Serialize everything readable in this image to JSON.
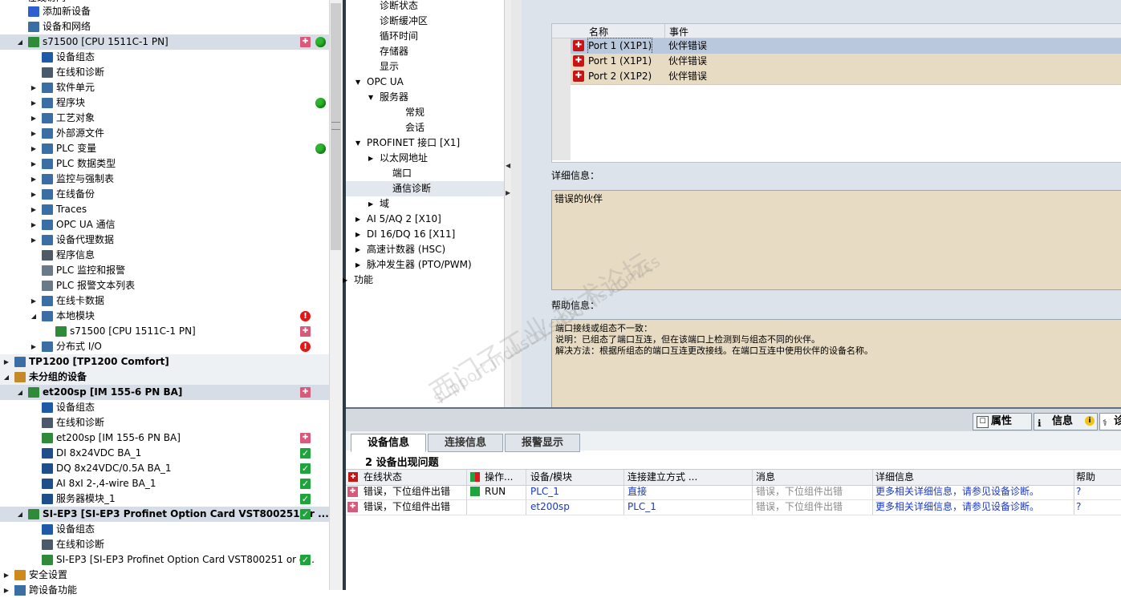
{
  "tree": {
    "top_partial": "在线访问",
    "items": [
      {
        "label": "添加新设备",
        "indent": 1,
        "icon": "add-device-icon"
      },
      {
        "label": "设备和网络",
        "indent": 1,
        "icon": "network-icon"
      },
      {
        "label": "s71500 [CPU 1511C-1 PN]",
        "indent": 1,
        "expanded": true,
        "bold": false,
        "selected": true,
        "icon": "plc-icon",
        "status": [
          "warn-plc",
          "green"
        ]
      },
      {
        "label": "设备组态",
        "indent": 2,
        "icon": "device-config-icon"
      },
      {
        "label": "在线和诊断",
        "indent": 2,
        "icon": "online-diag-icon"
      },
      {
        "label": "软件单元",
        "indent": 2,
        "collapsed": true,
        "icon": "folder-icon"
      },
      {
        "label": "程序块",
        "indent": 2,
        "collapsed": true,
        "icon": "folder-icon",
        "status": [
          "",
          "green"
        ]
      },
      {
        "label": "工艺对象",
        "indent": 2,
        "collapsed": true,
        "icon": "folder-icon"
      },
      {
        "label": "外部源文件",
        "indent": 2,
        "collapsed": true,
        "icon": "folder-icon"
      },
      {
        "label": "PLC 变量",
        "indent": 2,
        "collapsed": true,
        "icon": "folder-icon",
        "status": [
          "",
          "green"
        ]
      },
      {
        "label": "PLC 数据类型",
        "indent": 2,
        "collapsed": true,
        "icon": "folder-icon"
      },
      {
        "label": "监控与强制表",
        "indent": 2,
        "collapsed": true,
        "icon": "folder-icon"
      },
      {
        "label": "在线备份",
        "indent": 2,
        "collapsed": true,
        "icon": "folder-icon"
      },
      {
        "label": "Traces",
        "indent": 2,
        "collapsed": true,
        "icon": "folder-icon"
      },
      {
        "label": "OPC UA 通信",
        "indent": 2,
        "collapsed": true,
        "icon": "folder-icon"
      },
      {
        "label": "设备代理数据",
        "indent": 2,
        "collapsed": true,
        "icon": "folder-icon"
      },
      {
        "label": "程序信息",
        "indent": 2,
        "icon": "program-info-icon"
      },
      {
        "label": "PLC 监控和报警",
        "indent": 2,
        "icon": "alarm-icon"
      },
      {
        "label": "PLC 报警文本列表",
        "indent": 2,
        "icon": "text-list-icon"
      },
      {
        "label": "在线卡数据",
        "indent": 2,
        "collapsed": true,
        "icon": "folder-icon"
      },
      {
        "label": "本地模块",
        "indent": 2,
        "expanded": true,
        "icon": "folder-icon",
        "status": [
          "",
          "red"
        ]
      },
      {
        "label": "s71500 [CPU 1511C-1 PN]",
        "indent": 3,
        "icon": "module-icon",
        "status": [
          "",
          "warn-plc"
        ]
      },
      {
        "label": "分布式 I/O",
        "indent": 2,
        "collapsed": true,
        "icon": "folder-icon",
        "status": [
          "",
          "red"
        ]
      },
      {
        "label": "TP1200 [TP1200 Comfort]",
        "indent": 0,
        "collapsed": true,
        "bold": true,
        "group": true,
        "icon": "hmi-icon"
      },
      {
        "label": "未分组的设备",
        "indent": 0,
        "expanded": true,
        "bold": true,
        "group": true,
        "icon": "ungrouped-devices-icon"
      },
      {
        "label": "et200sp [IM 155-6 PN BA]",
        "indent": 1,
        "expanded": true,
        "bold": true,
        "selected": true,
        "icon": "device-icon",
        "status": [
          "",
          "warn-plc"
        ]
      },
      {
        "label": "设备组态",
        "indent": 2,
        "icon": "device-config-icon"
      },
      {
        "label": "在线和诊断",
        "indent": 2,
        "icon": "online-diag-icon"
      },
      {
        "label": "et200sp [IM 155-6 PN BA]",
        "indent": 2,
        "icon": "module-icon",
        "status": [
          "",
          "warn-plc"
        ]
      },
      {
        "label": "DI 8x24VDC BA_1",
        "indent": 2,
        "icon": "io-module-icon",
        "status": [
          "",
          "check"
        ]
      },
      {
        "label": "DQ 8x24VDC/0.5A BA_1",
        "indent": 2,
        "icon": "io-module-icon",
        "status": [
          "",
          "check"
        ]
      },
      {
        "label": "AI 8xI 2-,4-wire BA_1",
        "indent": 2,
        "icon": "io-module-icon",
        "status": [
          "",
          "check"
        ]
      },
      {
        "label": "服务器模块_1",
        "indent": 2,
        "icon": "io-module-icon",
        "status": [
          "",
          "check"
        ]
      },
      {
        "label": "SI-EP3 [SI-EP3 Profinet Option Card VST800251 or ...",
        "indent": 1,
        "expanded": true,
        "bold": true,
        "selected": true,
        "icon": "device-icon",
        "status": [
          "",
          "check"
        ]
      },
      {
        "label": "设备组态",
        "indent": 2,
        "icon": "device-config-icon"
      },
      {
        "label": "在线和诊断",
        "indent": 2,
        "icon": "online-diag-icon"
      },
      {
        "label": "SI-EP3 [SI-EP3 Profinet Option Card VST800251 or g...",
        "indent": 2,
        "icon": "module-icon",
        "status": [
          "",
          "check"
        ]
      },
      {
        "label": "安全设置",
        "indent": 0,
        "collapsed": true,
        "icon": "security-icon"
      }
    ],
    "bottom_partial": "跨设备功能"
  },
  "nav": {
    "items": [
      {
        "label": "诊断状态",
        "indent": 2
      },
      {
        "label": "诊断缓冲区",
        "indent": 2
      },
      {
        "label": "循环时间",
        "indent": 2
      },
      {
        "label": "存储器",
        "indent": 2
      },
      {
        "label": "显示",
        "indent": 2
      },
      {
        "label": "OPC UA",
        "indent": 1,
        "expanded": true
      },
      {
        "label": "服务器",
        "indent": 2,
        "expanded": true
      },
      {
        "label": "常规",
        "indent": 4
      },
      {
        "label": "会话",
        "indent": 4
      },
      {
        "label": "PROFINET 接口 [X1]",
        "indent": 1,
        "expanded": true
      },
      {
        "label": "以太网地址",
        "indent": 2,
        "collapsed": true
      },
      {
        "label": "端口",
        "indent": 3
      },
      {
        "label": "通信诊断",
        "indent": 3,
        "selected": true
      },
      {
        "label": "域",
        "indent": 2,
        "collapsed": true
      },
      {
        "label": "AI 5/AQ 2 [X10]",
        "indent": 1,
        "collapsed": true
      },
      {
        "label": "DI 16/DQ 16 [X11]",
        "indent": 1,
        "collapsed": true
      },
      {
        "label": "高速计数器 (HSC)",
        "indent": 1,
        "collapsed": true
      },
      {
        "label": "脉冲发生器 (PTO/PWM)",
        "indent": 1,
        "collapsed": true
      },
      {
        "label": "功能",
        "indent": 0,
        "collapsed": true
      }
    ]
  },
  "events": {
    "col_name": "名称",
    "col_event": "事件",
    "rows": [
      {
        "name": "Port 1 (X1P1)",
        "event": "伙伴错误",
        "selected": true
      },
      {
        "name": "Port 1 (X1P1)",
        "event": "伙伴错误"
      },
      {
        "name": "Port 2 (X1P2)",
        "event": "伙伴错误"
      }
    ]
  },
  "detail": {
    "label": "详细信息：",
    "text": "错误的伙伴"
  },
  "help": {
    "label": "帮助信息：",
    "lines": [
      "端口接线或组态不一致：",
      "说明：已组态了端口互连，但在该端口上检测到与组态不同的伙伴。",
      "解决方法：根据所组态的端口互连更改接线。在端口互连中使用伙伴的设备名称。"
    ]
  },
  "panel_tabs": {
    "properties": "属性",
    "info": "信息",
    "diag_partial": "诊"
  },
  "sub_tabs": [
    "设备信息",
    "连接信息",
    "报警显示"
  ],
  "issues_title": "2 设备出现问题",
  "table": {
    "headers": [
      "在线状态",
      "操作...",
      "设备/模块",
      "连接建立方式 ...",
      "消息",
      "详细信息",
      "帮助"
    ],
    "rows": [
      {
        "status": "错误，下位组件出错",
        "op": "RUN",
        "device": "PLC_1",
        "conn": "直接",
        "msg": "错误，下位组件出错",
        "detail": "更多相关详细信息，请参见设备诊断。",
        "help": "?"
      },
      {
        "status": "错误，下位组件出错",
        "op": "",
        "device": "et200sp",
        "conn": "PLC_1",
        "msg": "错误，下位组件出错",
        "detail": "更多相关详细信息，请参见设备诊断。",
        "help": "?"
      }
    ]
  },
  "watermark": {
    "cn": "西门子工业 技术论坛",
    "url": "support.industry.siemens.com/cs"
  },
  "colors": {
    "tree_selected": "#d6dde6",
    "event_row": "#e8dbc3",
    "event_selected": "#b9c8dc",
    "link": "#1a39c9",
    "ok_green": "#1fa33c",
    "error_red": "#e01818"
  }
}
